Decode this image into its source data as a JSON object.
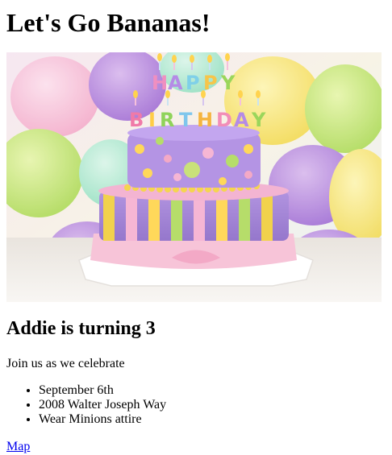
{
  "header": {
    "title": "Let's Go Bananas!"
  },
  "hero": {
    "image_alt": "birthday-cake-photo",
    "topper_text": [
      "HAPPY",
      "BIRTHDAY"
    ]
  },
  "event": {
    "heading": "Addie is turning 3",
    "intro": "Join us as we celebrate",
    "details": [
      "September 6th",
      "2008 Walter Joseph Way",
      "Wear Minions attire"
    ]
  },
  "links": {
    "map_label": "Map"
  }
}
